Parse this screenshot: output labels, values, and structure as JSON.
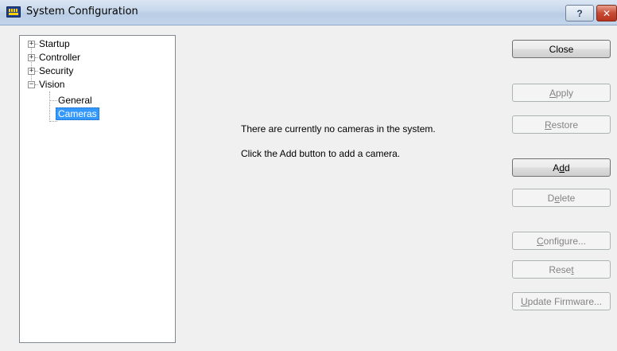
{
  "window": {
    "title": "System Configuration",
    "help_label": "?",
    "close_label": "✕"
  },
  "tree": {
    "items": [
      {
        "label": "Startup",
        "expander": "+"
      },
      {
        "label": "Controller",
        "expander": "+"
      },
      {
        "label": "Security",
        "expander": "+"
      },
      {
        "label": "Vision",
        "expander": "−"
      }
    ],
    "children": [
      {
        "label": "General"
      },
      {
        "label": "Cameras",
        "selected": true
      }
    ]
  },
  "message": {
    "line1": "There are currently no cameras in the system.",
    "line2": "Click the Add button to add a camera."
  },
  "buttons": {
    "close": {
      "label": "Close",
      "enabled": true
    },
    "apply": {
      "pre": "",
      "key": "A",
      "post": "pply",
      "enabled": false
    },
    "restore": {
      "pre": "",
      "key": "R",
      "post": "estore",
      "enabled": false
    },
    "add": {
      "pre": "A",
      "key": "d",
      "post": "d",
      "enabled": true
    },
    "delete": {
      "pre": "D",
      "key": "e",
      "post": "lete",
      "enabled": false
    },
    "configure": {
      "pre": "",
      "key": "C",
      "post": "onfigure...",
      "enabled": false
    },
    "reset": {
      "pre": "Rese",
      "key": "t",
      "post": "",
      "enabled": false
    },
    "update_firmware": {
      "pre": "",
      "key": "U",
      "post": "pdate Firmware...",
      "enabled": false
    }
  },
  "colors": {
    "selection": "#3399ff",
    "window_bg": "#f0f0f0",
    "close_button": "#c64a34"
  }
}
